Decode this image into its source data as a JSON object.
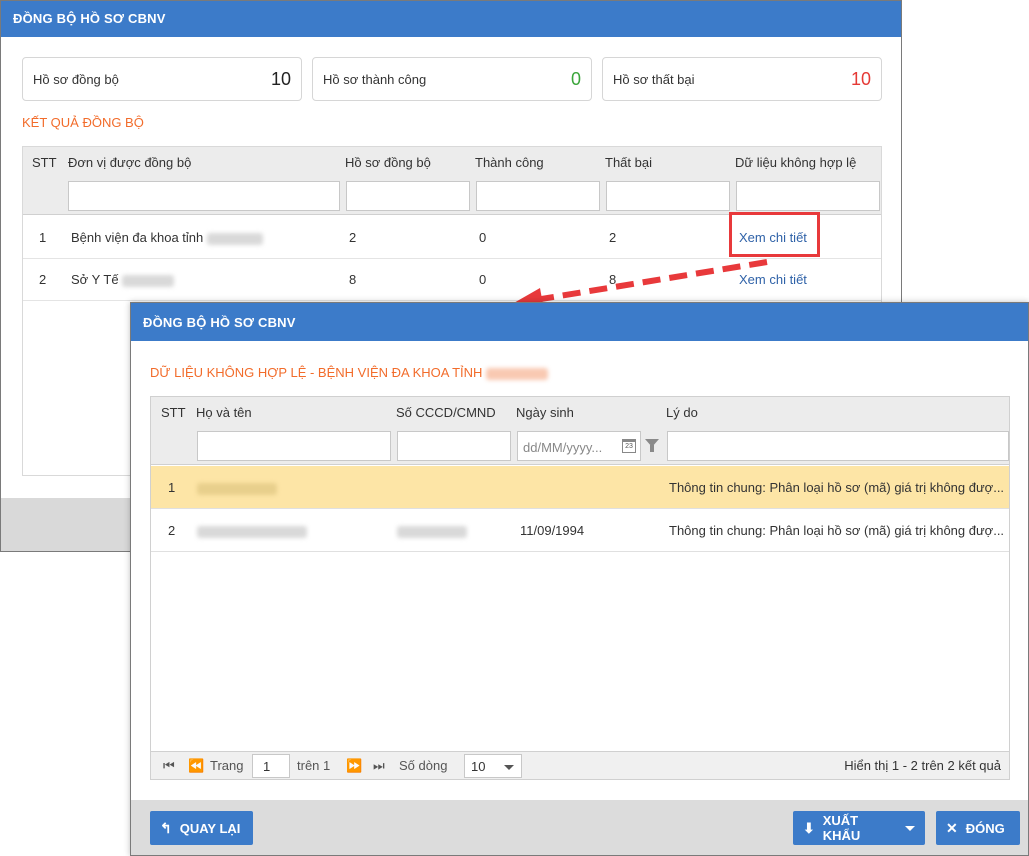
{
  "bg_dialog": {
    "title": "ĐỒNG BỘ HỒ SƠ CBNV",
    "stats": [
      {
        "label": "Hồ sơ đồng bộ",
        "value": "10",
        "color": "#222222"
      },
      {
        "label": "Hồ sơ thành công",
        "value": "0",
        "color": "#3aa53a"
      },
      {
        "label": "Hồ sơ thất bại",
        "value": "10",
        "color": "#e53935"
      }
    ],
    "section_label": "KẾT QUẢ ĐỒNG BỘ",
    "columns": [
      "STT",
      "Đơn vị được đồng bộ",
      "Hồ sơ đồng bộ",
      "Thành công",
      "Thất bại",
      "Dữ liệu không hợp lệ"
    ],
    "rows": [
      {
        "stt": "1",
        "unit": "Bệnh viện đa khoa tỉnh",
        "total": "2",
        "success": "0",
        "fail": "2",
        "link": "Xem chi tiết"
      },
      {
        "stt": "2",
        "unit": "Sở Y Tế",
        "total": "8",
        "success": "0",
        "fail": "8",
        "link": "Xem chi tiết"
      }
    ]
  },
  "fg_dialog": {
    "title": "ĐỒNG BỘ HỒ SƠ CBNV",
    "section_label": "DỮ LIỆU KHÔNG HỢP LỆ - BỆNH VIỆN ĐA KHOA TỈNH",
    "columns": [
      "STT",
      "Họ và tên",
      "Số CCCD/CMND",
      "Ngày sinh",
      "Lý do"
    ],
    "date_placeholder": "dd/MM/yyyy...",
    "rows": [
      {
        "stt": "1",
        "dob": "",
        "reason": "Thông tin chung: Phân loại hồ sơ (mã) giá trị không đượ..."
      },
      {
        "stt": "2",
        "dob": "11/09/1994",
        "reason": "Thông tin chung: Phân loại hồ sơ (mã) giá trị không đượ..."
      }
    ],
    "pager": {
      "page_label": "Trang",
      "page_value": "1",
      "of_label": "trên 1",
      "rows_label": "Số dòng",
      "rows_value": "10",
      "summary": "Hiển thị 1 - 2 trên 2 kết quả"
    },
    "buttons": {
      "back": "QUAY LẠI",
      "export": "XUẤT KHẨU",
      "close": "ĐÓNG"
    }
  },
  "colors": {
    "header_blue": "#3c7bc9",
    "accent_orange": "#f26c2b",
    "highlight_red": "#e8393b",
    "selected_row": "#fde5a6"
  }
}
